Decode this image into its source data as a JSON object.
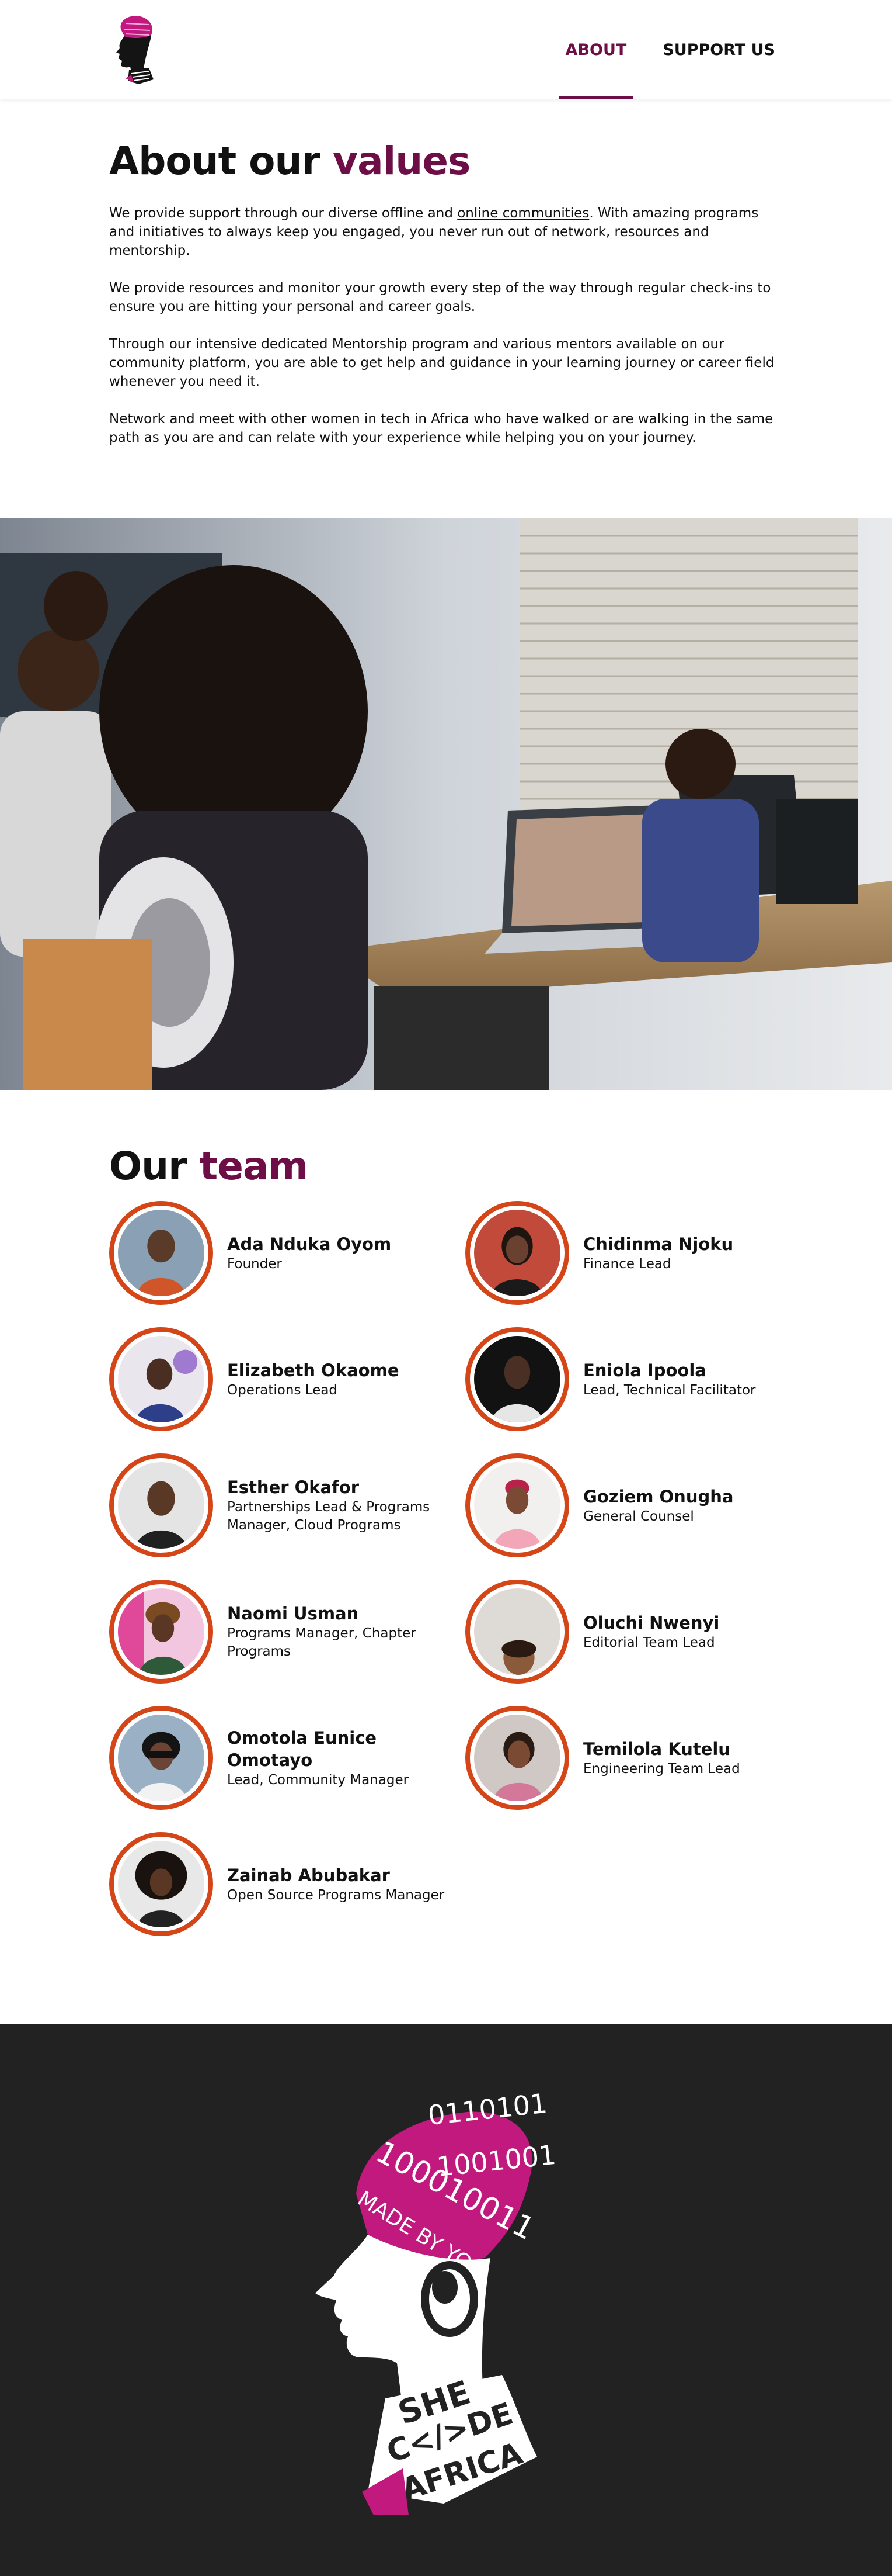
{
  "header": {
    "logo": {
      "icon": "she-code-africa-logo-icon"
    },
    "nav": [
      {
        "label": "ABOUT",
        "active": true
      },
      {
        "label": "SUPPORT US",
        "active": false
      }
    ]
  },
  "about": {
    "title_plain": "About our ",
    "title_accent": "values",
    "paragraphs": [
      {
        "before_link": "We provide support through our diverse offline and ",
        "link_text": "online communities",
        "after_link": ". With amazing programs and initiatives to always keep you engaged, you never run out of network, resources and mentorship."
      },
      {
        "text": "We provide resources and monitor your growth every step of the way through regular check-ins to ensure you are hitting your personal and career goals."
      },
      {
        "text": "Through our intensive dedicated Mentorship program and various mentors available on our community platform, you are able to get help and guidance in your learning journey or career field whenever you need it."
      },
      {
        "text": "Network and meet with other women in tech in Africa who have walked or are walking in the same path as you are and can relate with your experience while helping you on your journey."
      }
    ]
  },
  "photo": {
    "subject": "women-working-on-laptops-photo"
  },
  "team": {
    "title_plain": "Our ",
    "title_accent": "team",
    "members": [
      {
        "name": "Ada Nduka Oyom",
        "role": "Founder"
      },
      {
        "name": "Chidinma Njoku",
        "role": "Finance Lead"
      },
      {
        "name": "Elizabeth Okaome",
        "role": "Operations Lead"
      },
      {
        "name": "Eniola Ipoola",
        "role": "Lead, Technical Facilitator"
      },
      {
        "name": "Esther Okafor",
        "role": "Partnerships Lead & Programs Manager, Cloud Programs"
      },
      {
        "name": "Goziem Onugha",
        "role": "General Counsel"
      },
      {
        "name": "Naomi Usman",
        "role": "Programs Manager, Chapter Programs"
      },
      {
        "name": "Oluchi Nwenyi",
        "role": "Editorial Team Lead"
      },
      {
        "name": "Omotola Eunice Omotayo",
        "role": "Lead, Community Manager"
      },
      {
        "name": "Temilola Kutelu",
        "role": "Engineering Team Lead"
      },
      {
        "name": "Zainab Abubakar",
        "role": "Open Source Programs Manager"
      }
    ]
  },
  "footer": {
    "logo_text": {
      "binary_1": "0110101",
      "binary_2": "100010011",
      "binary_3": "1001001",
      "made_by": "MADE BY YO",
      "she": "SHE",
      "code": "C</>DE",
      "africa": "AFRICA"
    }
  },
  "colors": {
    "accent": "#6d0f46",
    "avatar_ring": "#d44617",
    "footer_bg": "#232222",
    "logo_pink": "#c2197f"
  }
}
